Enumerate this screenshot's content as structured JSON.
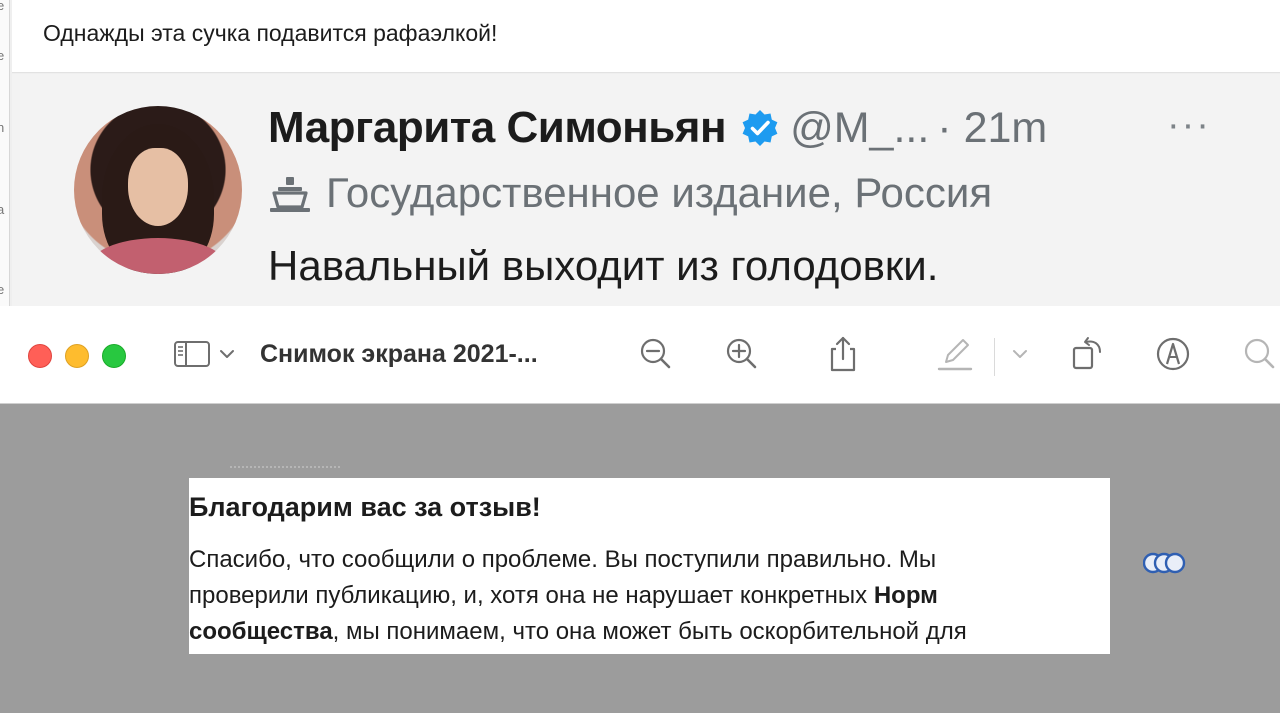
{
  "comment": {
    "text": "Однажды эта сучка подавится рафаэлкой!"
  },
  "tweet": {
    "author_name": "Маргарита Симоньян",
    "handle": "@M_...",
    "time": "· 21m",
    "more_label": "···",
    "state_label": "Государственное издание, Россия",
    "body": "Навальный выходит из голодовки."
  },
  "preview_toolbar": {
    "document_title": "Снимок экрана 2021-...",
    "icons": [
      "sidebar-icon",
      "chevron-down-icon",
      "zoom-out-icon",
      "zoom-in-icon",
      "share-icon",
      "highlight-pen-icon",
      "chevron-down-icon",
      "rotate-icon",
      "markup-icon",
      "search-icon"
    ]
  },
  "document": {
    "heading": "Благодарим вас за отзыв!",
    "line1": "Спасибо, что сообщили о проблеме. Вы поступили правильно. Мы",
    "line2_a": "проверили публикацию, и, хотя она не нарушает конкретных ",
    "line2_b": "Норм",
    "line3_a": "сообщества",
    "line3_b": ", мы понимаем, что она может быть оскорбительной для"
  },
  "colors": {
    "accent_verified": "#1d9bf0",
    "close": "#ff5f57",
    "minimize": "#febc2e",
    "maximize": "#28c840",
    "window_background": "#9c9c9c"
  }
}
